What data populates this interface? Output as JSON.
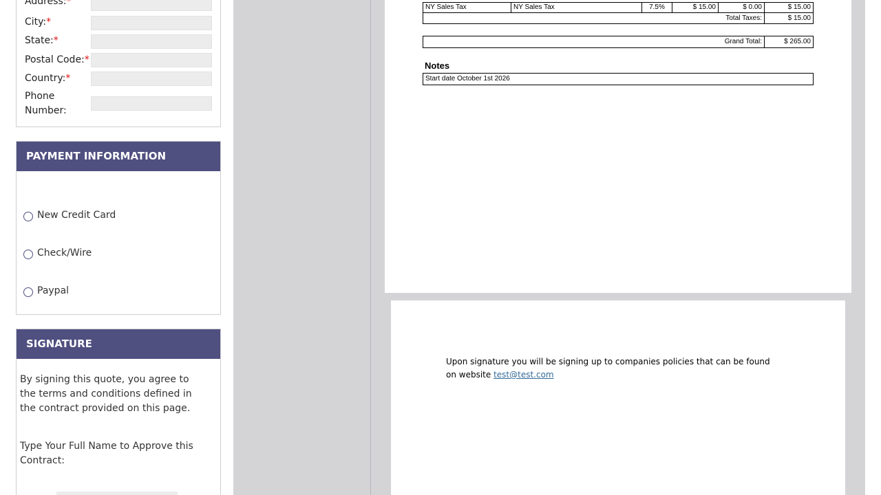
{
  "address_form": {
    "fields": [
      {
        "label": "Address:",
        "required": true
      },
      {
        "label": "City:",
        "required": true
      },
      {
        "label": "State:",
        "required": true
      },
      {
        "label": "Postal Code:",
        "required": true
      },
      {
        "label": "Country:",
        "required": true
      },
      {
        "label_line1": "Phone",
        "label_line2": "Number:",
        "required": false
      }
    ],
    "required_marker": "*"
  },
  "payment": {
    "title": "PAYMENT INFORMATION",
    "options": [
      "New Credit Card",
      "Check/Wire",
      "Paypal"
    ]
  },
  "signature": {
    "title": "SIGNATURE",
    "terms_text": "By signing this quote, you agree to the terms and conditions defined in the contract provided on this page.",
    "prompt_text": "Type Your Full Name to Approve this Contract:"
  },
  "document": {
    "tax_row": {
      "name": "NY Sales Tax",
      "description": "NY Sales Tax",
      "rate": "7.5%",
      "taxable": "$ 15.00",
      "exempt": "$ 0.00",
      "total": "$ 15.00"
    },
    "total_taxes_label": "Total Taxes:",
    "total_taxes_value": "$ 15.00",
    "grand_total_label": "Grand Total:",
    "grand_total_value": "$ 265.00",
    "notes_title": "Notes",
    "notes_text": "Start date October 1st 2026",
    "policy_text": "Upon signature you will be signing up to companies policies that can be found on website",
    "policy_link": "test@test.com"
  },
  "colors": {
    "header_bg": "#4f4f80",
    "required": "#e01010",
    "viewer_bg": "#d4d4d7",
    "link": "#336a98"
  }
}
